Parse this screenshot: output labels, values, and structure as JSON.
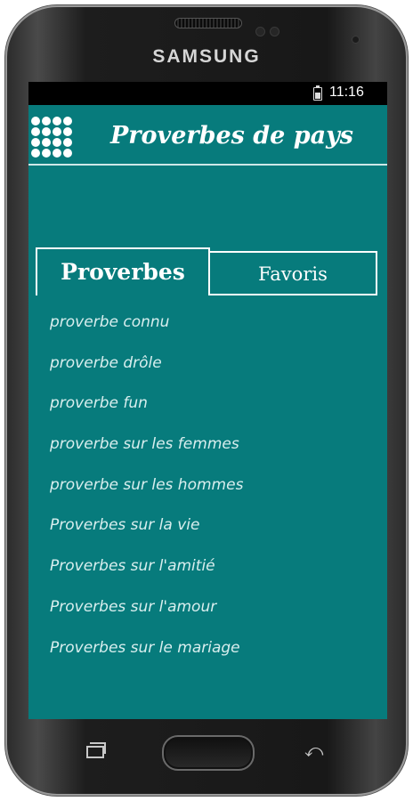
{
  "device": {
    "brand": "SAMSUNG"
  },
  "status_bar": {
    "time": "11:16",
    "battery_icon": "battery-charging-icon"
  },
  "app_bar": {
    "title": "Proverbes de pays",
    "menu_icon": "grid-dots-icon"
  },
  "tabs": [
    {
      "label": "Proverbes",
      "active": true
    },
    {
      "label": "Favoris",
      "active": false
    }
  ],
  "list": {
    "items": [
      "proverbe connu",
      "proverbe drôle",
      "proverbe fun",
      "proverbe sur les femmes",
      "proverbe sur les hommes",
      "Proverbes sur la vie",
      "Proverbes sur l'amitié",
      "Proverbes sur l'amour",
      "Proverbes sur le mariage"
    ]
  },
  "nav_bar": {
    "recent_icon": "recent-apps-icon",
    "home_icon": "home-button",
    "back_icon": "back-icon"
  },
  "colors": {
    "screen_bg": "#077b7c",
    "text_primary": "#ffffff",
    "list_text": "#d8eeee"
  }
}
